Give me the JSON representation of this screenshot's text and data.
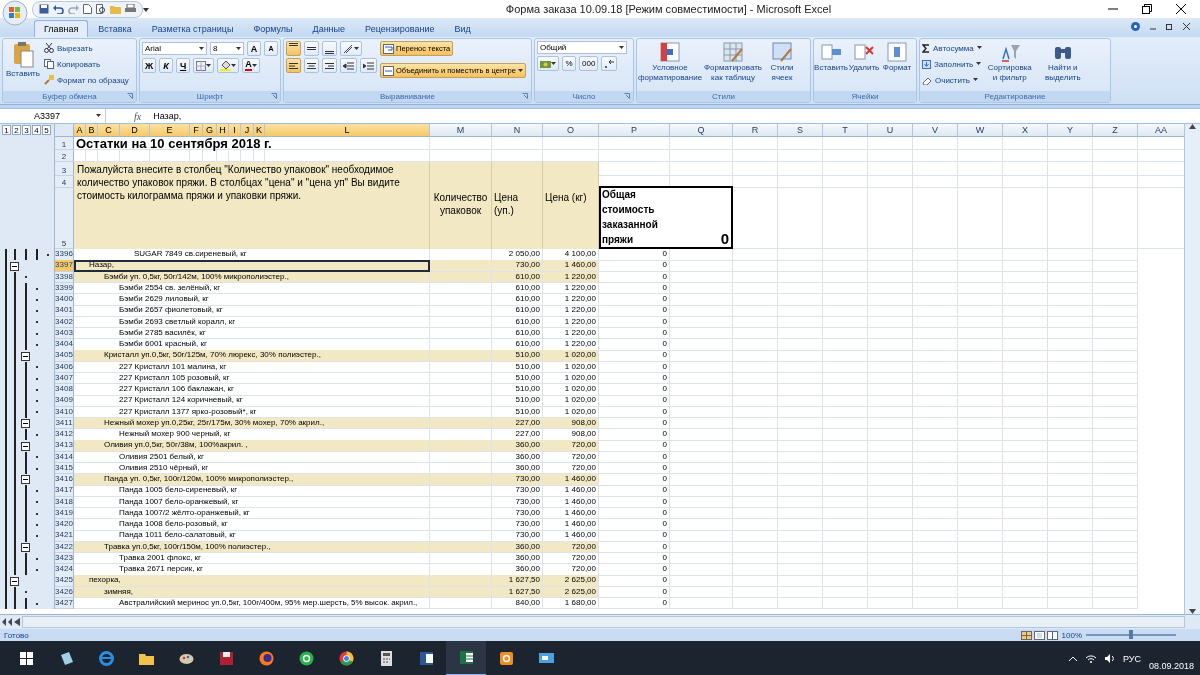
{
  "window": {
    "title": "Форма заказа 10.09.18  [Режим совместимости] - Microsoft Excel"
  },
  "tabs": [
    {
      "label": "Главная",
      "selected": true
    },
    {
      "label": "Вставка",
      "selected": false
    },
    {
      "label": "Разметка страницы",
      "selected": false
    },
    {
      "label": "Формулы",
      "selected": false
    },
    {
      "label": "Данные",
      "selected": false
    },
    {
      "label": "Рецензирование",
      "selected": false
    },
    {
      "label": "Вид",
      "selected": false
    }
  ],
  "ribbon": {
    "groups": [
      {
        "kind": "clipboard",
        "label": "Буфер обмена",
        "paste": "Вставить",
        "actions": [
          "Вырезать",
          "Копировать",
          "Формат по образцу"
        ]
      },
      {
        "kind": "font",
        "label": "Шрифт",
        "font": "Arial",
        "size": "8",
        "grow": "A",
        "shrink": "A",
        "styles": [
          "Ж",
          "К",
          "Ч"
        ],
        "color_letter": "A"
      },
      {
        "kind": "alignment",
        "label": "Выравнивание",
        "vertical": [
          {
            "selected": true
          },
          {
            "selected": false
          },
          {
            "selected": false
          }
        ],
        "horizontal": [
          {
            "selected": true
          },
          {
            "selected": false
          },
          {
            "selected": false
          }
        ],
        "wrap": {
          "label": "Перенос текста",
          "on": true
        },
        "merge": {
          "label": "Объединить и поместить в центре",
          "on": true
        }
      },
      {
        "kind": "number",
        "label": "Число",
        "format": "Общий",
        "buttons": [
          "%",
          "000"
        ]
      },
      {
        "kind": "styles",
        "label": "Стили",
        "buttons": [
          "Условное форматирование",
          "Форматировать как таблицу",
          "Стили ячеек"
        ]
      },
      {
        "kind": "cells",
        "label": "Ячейки",
        "buttons": [
          "Вставить",
          "Удалить",
          "Формат"
        ]
      },
      {
        "kind": "editing",
        "label": "Редактирование",
        "small": [
          "Автосумма",
          "Заполнить",
          "Очистить"
        ],
        "big": [
          "Сортировка и фильтр",
          "Найти и выделить"
        ]
      }
    ]
  },
  "formula_bar": {
    "name_box": "A3397",
    "function_label": "fx",
    "value": "Назар,"
  },
  "outline_levels": [
    "1",
    "2",
    "3",
    "4",
    "5"
  ],
  "columns": [
    {
      "label": "A",
      "selected": true
    },
    {
      "label": "B",
      "selected": true
    },
    {
      "label": "C",
      "selected": true
    },
    {
      "label": "D",
      "selected": true
    },
    {
      "label": "E",
      "selected": true
    },
    {
      "label": "F",
      "selected": true
    },
    {
      "label": "G",
      "selected": true
    },
    {
      "label": "H",
      "selected": true
    },
    {
      "label": "I",
      "selected": true
    },
    {
      "label": "J",
      "selected": true
    },
    {
      "label": "K",
      "selected": true
    },
    {
      "label": "L",
      "selected": true
    },
    {
      "label": "M",
      "selected": false
    },
    {
      "label": "N",
      "selected": false
    },
    {
      "label": "O",
      "selected": false
    },
    {
      "label": "P",
      "selected": false
    },
    {
      "label": "Q",
      "selected": false
    },
    {
      "label": "R",
      "selected": false
    },
    {
      "label": "S",
      "selected": false
    },
    {
      "label": "T",
      "selected": false
    },
    {
      "label": "U",
      "selected": false
    },
    {
      "label": "V",
      "selected": false
    },
    {
      "label": "W",
      "selected": false
    },
    {
      "label": "X",
      "selected": false
    },
    {
      "label": "Y",
      "selected": false
    },
    {
      "label": "Z",
      "selected": false
    },
    {
      "label": "AA",
      "selected": false
    }
  ],
  "header": {
    "row_numbers": [
      "1",
      "2",
      "3",
      "4",
      "5"
    ],
    "title": "Остатки на 10 сентября 2018 г.",
    "note": "Пожалуйста внесите в столбец \"Количество упаковок\" необходимое количество упаковок пряжи. В столбцах \"цена\" и \"цена уп\" Вы видите стоимость килограмма пряжи и упаковки пряжи.",
    "quantity": "Количество упаковок",
    "price_pack": "Цена (уп.)",
    "price_kg": "Цена (кг)",
    "total_label": "Общая стоимость заказанной пряжи",
    "total_value": "0"
  },
  "rows_above": [
    {
      "number": "3396",
      "text": "SUGAR 7849 св.сиреневый, кг",
      "n": "2 050,00",
      "o": "4 100,00",
      "p": "0",
      "kind": "item",
      "selected": false
    }
  ],
  "rows": [
    {
      "number": "3397",
      "text": "Назар,",
      "n": "730,00",
      "o": "1 460,00",
      "p": "0",
      "kind": "group",
      "selected": true,
      "expanded": true,
      "children": [
        {
          "number": "3398",
          "text": "Бэмби уп. 0,5кг, 50г/142м, 100% микрополиэстер.,",
          "n": "610,00",
          "o": "1 220,00",
          "p": "0",
          "kind": "group",
          "selected": false,
          "children": [
            {
              "number": "3399",
              "text": "Бэмби 2554 св. зелёный, кг",
              "n": "610,00",
              "o": "1 220,00",
              "p": "0",
              "kind": "item",
              "selected": false
            },
            {
              "number": "3400",
              "text": "Бэмби 2629 лиловый, кг",
              "n": "610,00",
              "o": "1 220,00",
              "p": "0",
              "kind": "item",
              "selected": false
            },
            {
              "number": "3401",
              "text": "Бэмби 2657 фиолетовый, кг",
              "n": "610,00",
              "o": "1 220,00",
              "p": "0",
              "kind": "item",
              "selected": false
            },
            {
              "number": "3402",
              "text": "Бэмби 2693 светлый коралл, кг",
              "n": "610,00",
              "o": "1 220,00",
              "p": "0",
              "kind": "item",
              "selected": false
            },
            {
              "number": "3403",
              "text": "Бэмби 2785 василёк, кг",
              "n": "610,00",
              "o": "1 220,00",
              "p": "0",
              "kind": "item",
              "selected": false
            },
            {
              "number": "3404",
              "text": "Бэмби 6001 красный, кг",
              "n": "610,00",
              "o": "1 220,00",
              "p": "0",
              "kind": "item",
              "selected": false
            }
          ]
        },
        {
          "number": "3405",
          "text": "Кристалл уп.0,5кг, 50г/125м, 70% люрекс, 30% полиэстер.,",
          "n": "510,00",
          "o": "1 020,00",
          "p": "0",
          "kind": "group",
          "selected": false,
          "expanded": true,
          "children": [
            {
              "number": "3406",
              "text": "227 Кристалл 101 малина, кг",
              "n": "510,00",
              "o": "1 020,00",
              "p": "0",
              "kind": "item",
              "selected": false
            },
            {
              "number": "3407",
              "text": "227 Кристалл 105 розовый, кг",
              "n": "510,00",
              "o": "1 020,00",
              "p": "0",
              "kind": "item",
              "selected": false
            },
            {
              "number": "3408",
              "text": "227 Кристалл 106 баклажан, кг",
              "n": "510,00",
              "o": "1 020,00",
              "p": "0",
              "kind": "item",
              "selected": false
            },
            {
              "number": "3409",
              "text": "227 Кристалл 124 коричневый, кг",
              "n": "510,00",
              "o": "1 020,00",
              "p": "0",
              "kind": "item",
              "selected": false
            },
            {
              "number": "3410",
              "text": "227 Кристалл 1377 ярко-розовый*, кг",
              "n": "510,00",
              "o": "1 020,00",
              "p": "0",
              "kind": "item",
              "selected": false
            }
          ]
        },
        {
          "number": "3411",
          "text": "Нежный мохер уп.0,25кг, 25г/175м, 30% мохер, 70% акрил.,",
          "n": "227,00",
          "o": "908,00",
          "p": "0",
          "kind": "group",
          "selected": false,
          "expanded": true,
          "children": [
            {
              "number": "3412",
              "text": "Нежный мохер 900 черный, кг",
              "n": "227,00",
              "o": "908,00",
              "p": "0",
              "kind": "item",
              "selected": false
            }
          ]
        },
        {
          "number": "3413",
          "text": "Оливия уп.0,5кг, 50г/38м, 100%акрил. ,",
          "n": "360,00",
          "o": "720,00",
          "p": "0",
          "kind": "group",
          "selected": false,
          "expanded": true,
          "children": [
            {
              "number": "3414",
              "text": "Оливия 2501 белый, кг",
              "n": "360,00",
              "o": "720,00",
              "p": "0",
              "kind": "item",
              "selected": false
            },
            {
              "number": "3415",
              "text": "Оливия 2510 чёрный, кг",
              "n": "360,00",
              "o": "720,00",
              "p": "0",
              "kind": "item",
              "selected": false
            }
          ]
        },
        {
          "number": "3416",
          "text": "Панда уп. 0,5кг, 100г/120м, 100% микрополиэстер.,",
          "n": "730,00",
          "o": "1 460,00",
          "p": "0",
          "kind": "group",
          "selected": false,
          "expanded": true,
          "children": [
            {
              "number": "3417",
              "text": "Панда 1005 бело-сиреневый, кг",
              "n": "730,00",
              "o": "1 460,00",
              "p": "0",
              "kind": "item",
              "selected": false
            },
            {
              "number": "3418",
              "text": "Панда 1007 бело-оранжевый, кг",
              "n": "730,00",
              "o": "1 460,00",
              "p": "0",
              "kind": "item",
              "selected": false
            },
            {
              "number": "3419",
              "text": "Панда 1007/2 жёлто-оранжевый, кг",
              "n": "730,00",
              "o": "1 460,00",
              "p": "0",
              "kind": "item",
              "selected": false
            },
            {
              "number": "3420",
              "text": "Панда 1008 бело-розовый, кг",
              "n": "730,00",
              "o": "1 460,00",
              "p": "0",
              "kind": "item",
              "selected": false
            },
            {
              "number": "3421",
              "text": "Панда 1011 бело-салатовый, кг",
              "n": "730,00",
              "o": "1 460,00",
              "p": "0",
              "kind": "item",
              "selected": false
            }
          ]
        },
        {
          "number": "3422",
          "text": "Травка уп.0,5кг, 100г/150м, 100% полиэстер.,",
          "n": "360,00",
          "o": "720,00",
          "p": "0",
          "kind": "group",
          "selected": false,
          "expanded": true,
          "children": [
            {
              "number": "3423",
              "text": "Травка 2001 флокс, кг",
              "n": "360,00",
              "o": "720,00",
              "p": "0",
              "kind": "item",
              "selected": false
            },
            {
              "number": "3424",
              "text": "Травка 2671 персик, кг",
              "n": "360,00",
              "o": "720,00",
              "p": "0",
              "kind": "item",
              "selected": false
            }
          ]
        }
      ]
    },
    {
      "number": "3425",
      "text": "пехорка,",
      "n": "1 627,50",
      "o": "2 625,00",
      "p": "0",
      "kind": "group",
      "selected": false,
      "expanded": true,
      "children": [
        {
          "number": "3426",
          "text": "зимняя,",
          "n": "1 627,50",
          "o": "2 625,00",
          "p": "0",
          "kind": "group",
          "selected": false,
          "children": [
            {
              "number": "3427",
              "text": "Австралийский меринос уп.0,5кг, 100г/400м, 95% мер.шерсть, 5% высок. акрил.,",
              "n": "840,00",
              "o": "1 680,00",
              "p": "0",
              "kind": "item",
              "selected": false
            }
          ]
        }
      ]
    }
  ],
  "status_bar": {
    "text": "Готово",
    "zoom": "100%",
    "zoom_level": {
      "level": 0.5
    }
  },
  "taskbar": {
    "language": "РУС",
    "date": "08.09.2018"
  }
}
